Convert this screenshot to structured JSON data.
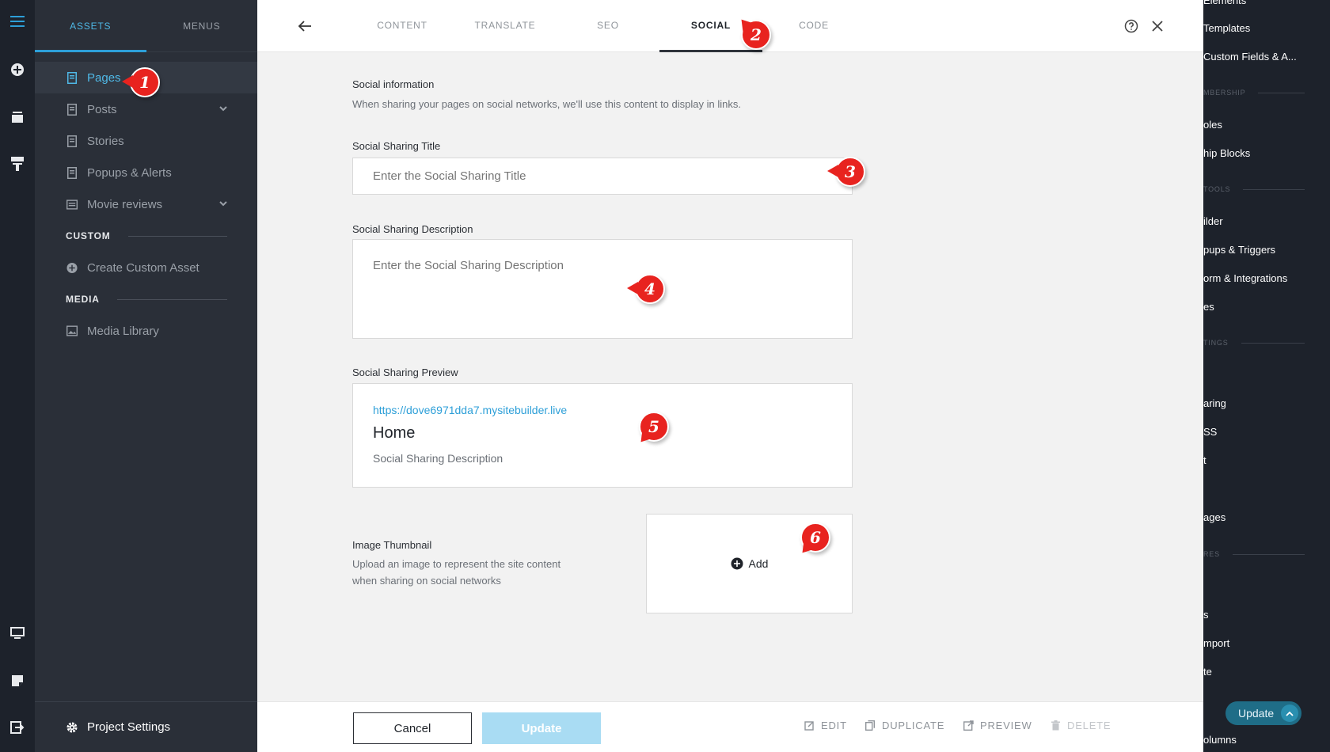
{
  "left_panel": {
    "tabs": [
      {
        "label": "ASSETS",
        "active": true
      },
      {
        "label": "MENUS",
        "active": false
      }
    ],
    "items": [
      {
        "label": "Pages",
        "icon": "page-icon",
        "active": true
      },
      {
        "label": "Posts",
        "icon": "page-icon",
        "has_chevron": true
      },
      {
        "label": "Stories",
        "icon": "page-icon"
      },
      {
        "label": "Popups & Alerts",
        "icon": "page-icon"
      },
      {
        "label": "Movie reviews",
        "icon": "collection-icon",
        "has_chevron": true
      }
    ],
    "custom_heading": "CUSTOM",
    "custom_items": [
      {
        "label": "Create Custom Asset",
        "icon": "plus-circle-icon"
      }
    ],
    "media_heading": "MEDIA",
    "media_items": [
      {
        "label": "Media Library",
        "icon": "image-icon"
      }
    ],
    "project_settings": "Project Settings"
  },
  "topbar": {
    "tabs": [
      {
        "label": "CONTENT"
      },
      {
        "label": "TRANSLATE"
      },
      {
        "label": "SEO"
      },
      {
        "label": "SOCIAL",
        "active": true
      },
      {
        "label": "CODE"
      }
    ]
  },
  "social": {
    "info_title": "Social information",
    "info_desc": "When sharing your pages on social networks, we'll use this content to display in links.",
    "title_label": "Social Sharing Title",
    "title_placeholder": "Enter the Social Sharing Title",
    "desc_label": "Social Sharing Description",
    "desc_placeholder": "Enter the Social Sharing Description",
    "preview_label": "Social Sharing Preview",
    "preview_url": "https://dove6971dda7.mysitebuilder.live",
    "preview_title": "Home",
    "preview_desc": "Social Sharing Description",
    "thumb_label": "Image Thumbnail",
    "thumb_desc_1": "Upload an image to represent the site content",
    "thumb_desc_2": "when sharing on social networks",
    "add_label": "Add"
  },
  "footer": {
    "cancel": "Cancel",
    "update": "Update",
    "edit": "EDIT",
    "duplicate": "DUPLICATE",
    "preview": "PREVIEW",
    "delete": "DELETE"
  },
  "right_panel": {
    "items": [
      "Templates",
      "Custom Fields & A...",
      "oles",
      "hip Blocks",
      "ilder",
      "pups & Triggers",
      "orm & Integrations",
      "es",
      "aring",
      "SS",
      "t",
      "ages",
      "s",
      "mport",
      "te",
      "olumns"
    ],
    "sections": [
      "MBERSHIP",
      "TOOLS",
      "TINGS",
      "RES"
    ],
    "partial_top": "Elements",
    "update": "Update"
  },
  "markers": [
    "1",
    "2",
    "3",
    "4",
    "5",
    "6"
  ],
  "colors": {
    "accent": "#2d9fd8",
    "marker": "#e8231f",
    "update_disabled": "#a9dcf3"
  }
}
